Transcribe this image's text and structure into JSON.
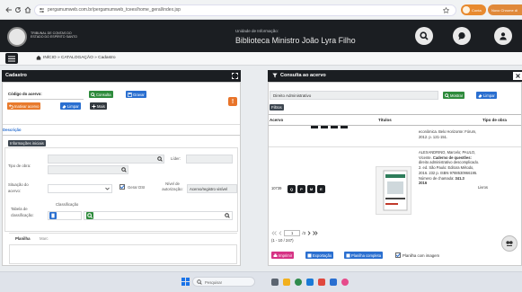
{
  "browser": {
    "url": "pergamumweb.com.br/pergamumweb_tcees/home_geral/index.jsp",
    "profile_label": "Conta",
    "right_label": "Novo Chrome di"
  },
  "header": {
    "logo_text": "TRIBUNAL DE CONTAS DO ESTADO DO ESPÍRITO SANTO",
    "unit_label": "Unidade de Informação:",
    "unit_name": "Biblioteca Ministro João Lyra Filho"
  },
  "breadcrumb": "INÍCIO » CATALOGAÇÃO » Cadastro",
  "cadastro": {
    "title": "Cadastro",
    "codigo_label": "Código do acervo:",
    "consulta_label": "Consulta",
    "gravar_label": "Gravar",
    "inativar_label": "Inativar acervo",
    "limpar_label": "Limpar",
    "mais_label": "Mais",
    "warning_label": "!",
    "tab_descricao": "Descrição",
    "tab_informacoes": "Informações iniciais",
    "lider_label": "Líder:",
    "tipo_obra_label": "Tipo de obra:",
    "situacao_label": "Situação do acervo:",
    "gerar_dsi_label": "Gerar DSI",
    "nivel_autorizacao_label": "Nível de autorização:",
    "nivel_autorizacao_value": "Acervo/registro visível",
    "tabela_classificacao_label": "Tabela de classificação:",
    "classificacao_label": "Classificação",
    "tab_planilha": "Planilha",
    "tab_marc": "Marc"
  },
  "consulta": {
    "title": "Consulta ao acervo",
    "search_value": "Direito Administrativo",
    "mostrar_label": "Mostrar",
    "limpar_label": "Limpar",
    "filtros_label": "Filtros",
    "col_acervo": "Acervo",
    "col_titulos": "Títulos",
    "col_tipo": "Tipo de obra",
    "row_prev_text": "econômica. Belo Horizonte: Fórum, 2012. p. 121-151.",
    "row": {
      "acervo": "10739",
      "tool_labels": [
        "Q",
        "P",
        "M",
        "E"
      ],
      "title_text_before": "ALEXANDRINO, Marcelo; PAULO, Vicente.",
      "title_bold": "Caderno de questões:",
      "title_text_after": "direito administrativo descomplicado. 2. ed. São Paulo: Editora Método, 2016. 232 p. ISBN 9788530966195. Número de chamada:",
      "call_number": "341.3",
      "year": "2016",
      "tipo": "Livros"
    },
    "pagination": {
      "current": "1",
      "total": "/3",
      "range": "(1 - 10 / 247)"
    },
    "imprimir_label": "Imprimir",
    "exportacao_label": "Exportação",
    "planilha_completa_label": "Planilha completa",
    "planilha_imagem_label": "Planilha com imagem"
  },
  "taskbar": {
    "search_placeholder": "Pesquisar"
  },
  "colors": {
    "header_bg": "#1b1e22",
    "accent_green": "#2e8b3c",
    "accent_blue": "#2a6fd0",
    "accent_orange": "#e87b2e",
    "accent_magenta": "#d63384"
  }
}
